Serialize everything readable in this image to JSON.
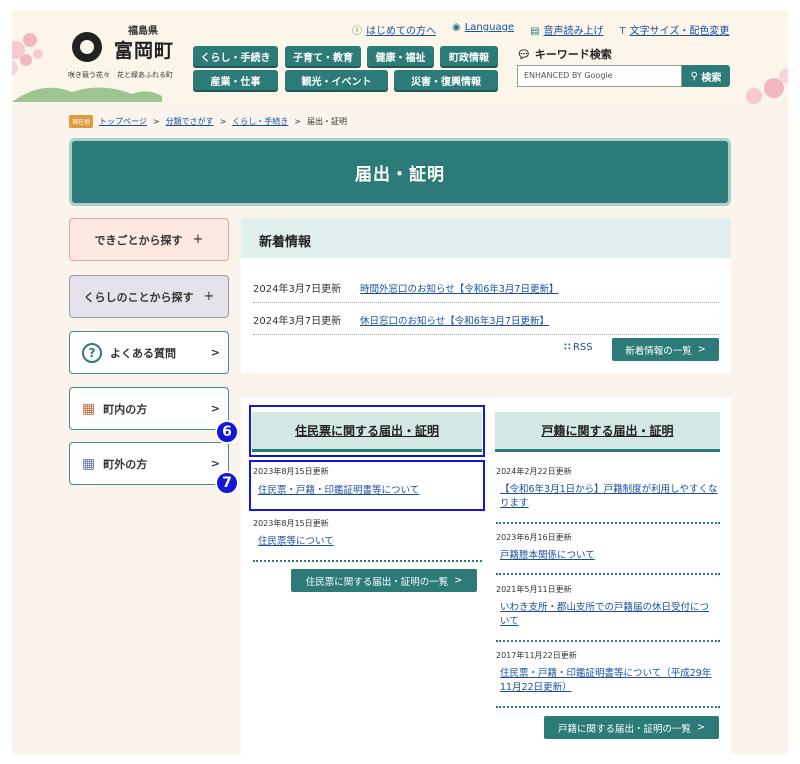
{
  "header": {
    "prefecture": "福島県",
    "town_name": "富岡町",
    "tagline": "咲き競う花々　花と緑あふれる町",
    "utility_links": [
      {
        "icon": "info-icon",
        "label": "はじめての方へ"
      },
      {
        "icon": "globe-icon",
        "label": "Language"
      },
      {
        "icon": "speaker-icon",
        "label": "音声読み上げ"
      },
      {
        "icon": "text-size-icon",
        "label": "文字サイズ・配色変更"
      }
    ],
    "nav": [
      "くらし・手続き",
      "子育て・教育",
      "健康・福祉",
      "町政情報",
      "産業・仕事",
      "観光・イベント",
      "災害・復興情報"
    ],
    "keyword_label": "キーワード検索",
    "search_placeholder": "ENHANCED BY Google",
    "search_button": "検索"
  },
  "breadcrumb": {
    "badge": "現在地",
    "items": [
      "トップページ",
      "分類でさがす",
      "くらし・手続き"
    ],
    "current": "届出・証明"
  },
  "page_title": "届出・証明",
  "sidebar": {
    "items": [
      {
        "label": "できごとから探す",
        "suffix": "+"
      },
      {
        "label": "くらしのことから探す",
        "suffix": "+"
      },
      {
        "label": "よくある質問",
        "suffix": ">"
      },
      {
        "label": "町内の方",
        "suffix": ">"
      },
      {
        "label": "町外の方",
        "suffix": ">"
      }
    ]
  },
  "news": {
    "heading": "新着情報",
    "items": [
      {
        "date": "2024年3月7日更新",
        "title": "時間外窓口のお知らせ【令和6年3月7日更新】"
      },
      {
        "date": "2024年3月7日更新",
        "title": "休日窓口のお知らせ【令和6年3月7日更新】"
      }
    ],
    "rss": "RSS",
    "more": "新着情報の一覧"
  },
  "juminhyo": {
    "heading": "住民票に関する届出・証明",
    "entries": [
      {
        "date": "2023年8月15日更新",
        "title": "住民票・戸籍・印鑑証明書等について"
      },
      {
        "date": "2023年8月15日更新",
        "title": "住民票等について"
      }
    ],
    "more": "住民票に関する届出・証明の一覧"
  },
  "koseki": {
    "heading": "戸籍に関する届出・証明",
    "entries": [
      {
        "date": "2024年2月22日更新",
        "title": "【令和6年3月1日から】戸籍制度が利用しやすくなります"
      },
      {
        "date": "2023年6月16日更新",
        "title": "戸籍謄本関係について"
      },
      {
        "date": "2021年5月11日更新",
        "title": "いわき支所・郡山支所での戸籍届の休日受付について"
      },
      {
        "date": "2017年11月22日更新",
        "title": "住民票・戸籍・印鑑証明書等について（平成29年11月22日更新）"
      }
    ],
    "more": "戸籍に関する届出・証明の一覧"
  },
  "annotations": {
    "marker_a": "6",
    "marker_b": "7"
  },
  "colors": {
    "accent": "#2d7b78",
    "marker": "#1418d6",
    "link": "#1a4f9c"
  }
}
